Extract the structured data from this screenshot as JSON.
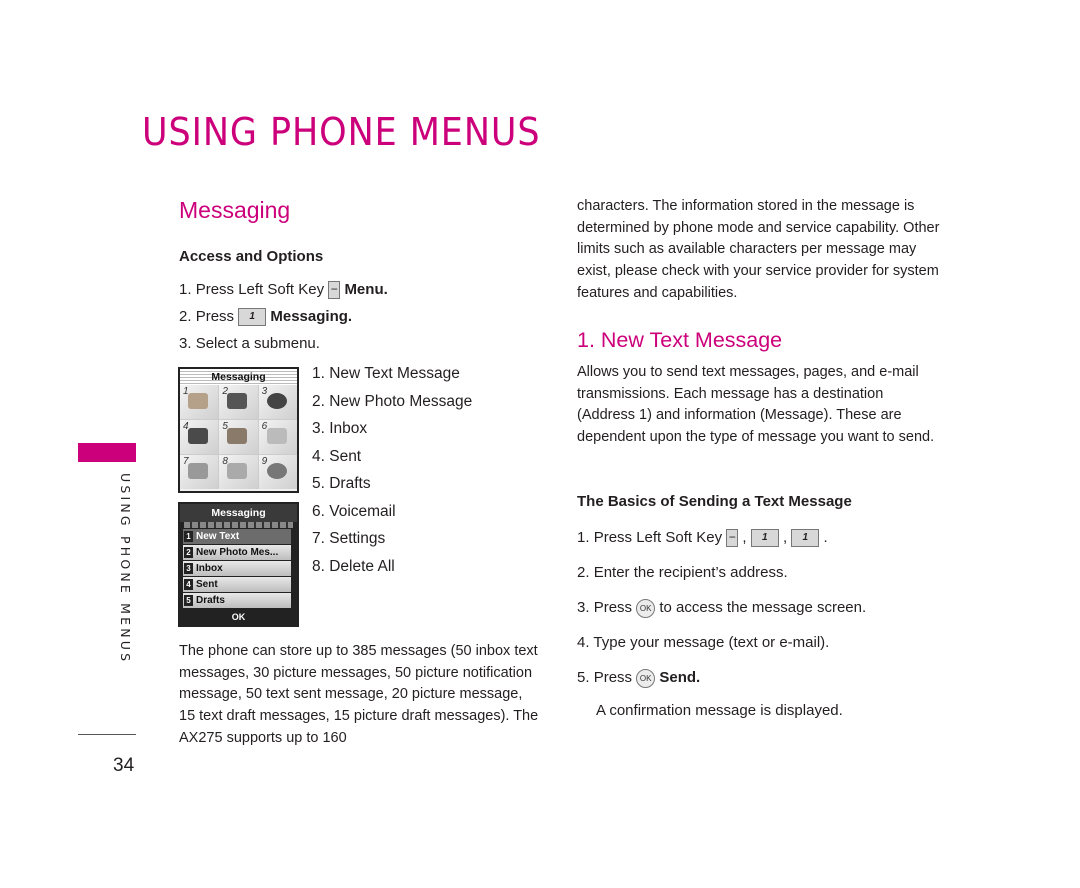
{
  "page": {
    "title": "USING PHONE MENUS",
    "side_label": "USING PHONE MENUS",
    "page_number": "34",
    "accent_color": "#cc007a"
  },
  "left": {
    "section_title": "Messaging",
    "subsection": "Access and Options",
    "steps": [
      {
        "num": "1.",
        "text": "Press Left Soft Key",
        "key": "soft-key-icon",
        "key_label": "−",
        "bold": "Menu."
      },
      {
        "num": "2.",
        "text": "Press",
        "key": "key-1-icon",
        "key_label": "1",
        "bold": "Messaging."
      },
      {
        "num": "3.",
        "text": "Select a submenu."
      }
    ],
    "submenu": [
      "1. New Text Message",
      "2. New Photo Message",
      "3. Inbox",
      "4. Sent",
      "5. Drafts",
      "6. Voicemail",
      "7. Settings",
      "8. Delete All"
    ],
    "screen1": {
      "title": "Messaging",
      "grid_numbers": [
        "1",
        "2",
        "3",
        "4",
        "5",
        "6",
        "7",
        "8",
        "9"
      ]
    },
    "screen2": {
      "title": "Messaging",
      "items": [
        {
          "num": "1",
          "label": "New Text"
        },
        {
          "num": "2",
          "label": "New Photo Mes..."
        },
        {
          "num": "3",
          "label": "Inbox"
        },
        {
          "num": "4",
          "label": "Sent"
        },
        {
          "num": "5",
          "label": "Drafts"
        }
      ],
      "ok_label": "OK"
    },
    "paragraph": "The phone can store up to 385 messages (50 inbox text messages, 30 picture messages, 50 picture notification message, 50 text sent message, 20 picture message, 15 text draft messages, 15 picture draft messages). The AX275 supports up to 160"
  },
  "right": {
    "paragraph1": "characters. The information stored in the message is determined by phone mode and service capability. Other limits such as available characters per message may exist, please check with your service provider for system features and capabilities.",
    "section_title": "1. New Text Message",
    "paragraph2": "Allows you to send text messages, pages, and e-mail transmissions. Each message has a destination (Address 1) and information (Message). These are dependent upon the type of message you want to send.",
    "subsection": "The Basics of Sending a Text Message",
    "steps": [
      {
        "num": "1.",
        "text": "Press Left Soft Key",
        "keys": [
          "−",
          "1",
          "1"
        ]
      },
      {
        "num": "2.",
        "text": "Enter the recipient’s address."
      },
      {
        "num": "3.",
        "text": "Press",
        "ok": "OK",
        "after": "to access the message screen."
      },
      {
        "num": "4.",
        "text": "Type your message (text or e-mail)."
      },
      {
        "num": "5.",
        "text": "Press",
        "ok": "OK",
        "bold": "Send."
      }
    ],
    "note": "A confirmation message is displayed."
  }
}
